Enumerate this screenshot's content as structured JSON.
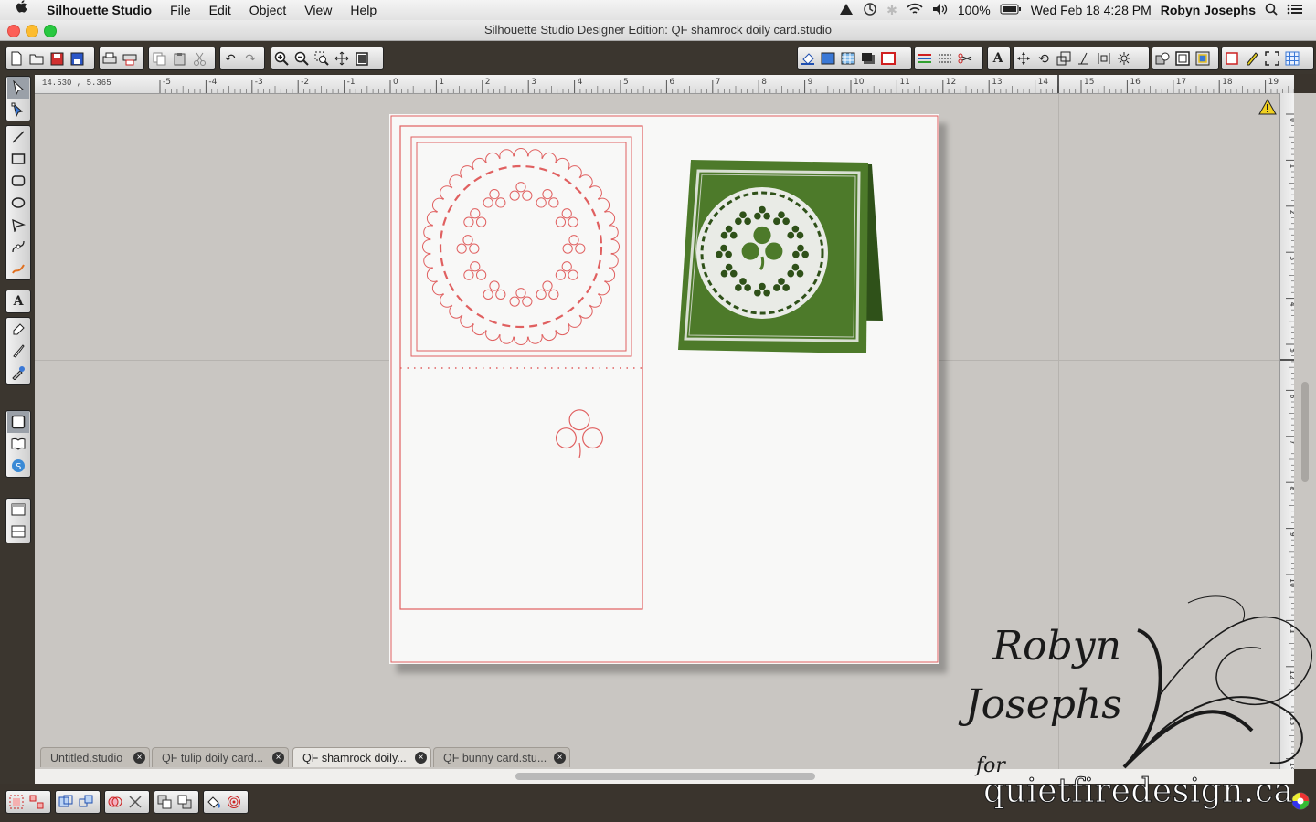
{
  "menubar": {
    "apple": "",
    "app_name": "Silhouette Studio",
    "menus": [
      "File",
      "Edit",
      "Object",
      "View",
      "Help"
    ],
    "battery": "100%",
    "datetime": "Wed Feb 18  4:28 PM",
    "user": "Robyn Josephs"
  },
  "window": {
    "title": "Silhouette Studio Designer Edition: QF shamrock doily card.studio"
  },
  "ruler": {
    "coords": "14.530 , 5.365",
    "h_labels": [
      "-5",
      "-4",
      "-3",
      "-2",
      "-1",
      "0",
      "1",
      "2",
      "3",
      "4",
      "5",
      "6",
      "7",
      "8",
      "9",
      "10",
      "11",
      "12",
      "13",
      "14",
      "15",
      "16",
      "17",
      "18",
      "19"
    ],
    "v_labels": [
      "0",
      "1",
      "2",
      "3",
      "4",
      "5",
      "6",
      "7",
      "8",
      "9",
      "10",
      "11",
      "12",
      "13",
      "14"
    ]
  },
  "tabs": [
    {
      "label": "Untitled.studio",
      "active": false
    },
    {
      "label": "QF tulip doily card...",
      "active": false
    },
    {
      "label": "QF shamrock doily...",
      "active": true
    },
    {
      "label": "QF bunny card.stu...",
      "active": false
    }
  ],
  "watermark": {
    "line1": "Robyn",
    "line2": "Josephs",
    "line3": "for",
    "line4": "quietfiredesign.ca"
  },
  "colors": {
    "cut_line": "#e06060",
    "card_green": "#4d7a2a",
    "card_dark": "#2f5119",
    "doily": "#e9ebe6"
  }
}
